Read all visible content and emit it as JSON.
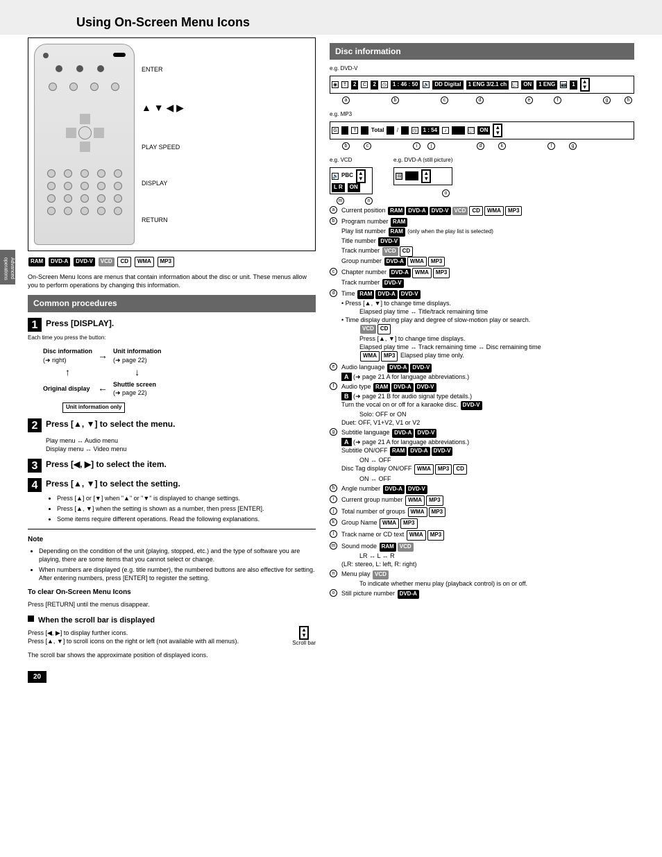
{
  "page": {
    "number": "20",
    "side_tab": "Advanced operations",
    "title": "Using On-Screen Menu Icons"
  },
  "remote_labels": {
    "enter": "ENTER",
    "arrows": "▲ ▼ ◀ ▶",
    "play_speed": "PLAY SPEED",
    "display": "DISPLAY",
    "return": "RETURN"
  },
  "format_row": {
    "ram": "RAM",
    "dvda": "DVD-A",
    "dvdv": "DVD-V",
    "vcd": "VCD",
    "cd": "CD",
    "wma": "WMA",
    "mp3": "MP3"
  },
  "intro": "On-Screen Menu Icons are menus that contain information about the disc or unit. These menus allow you to perform operations by changing this information.",
  "common_section": {
    "bar": "Common procedures",
    "step1_label": "Press [DISPLAY].",
    "flow": {
      "disc_info_top": "Disc information",
      "disc_info_sub": "(➜ right)",
      "unit_info_top": "Unit information",
      "unit_info_sub": "(➜ page 22)",
      "shuttle_top": "Shuttle screen",
      "shuttle_sub": "(➜ page 22)",
      "orig_top": "Original display",
      "unit_box": "Unit information only"
    },
    "step2_label": "Press [▲, ▼] to select the menu.",
    "step2_flow": "Play menu ↔ Audio menu\nDisplay menu ↔ Video menu",
    "step3_label": "Press [◀, ▶] to select the item.",
    "step4_label": "Press [▲, ▼] to select the setting.",
    "bullets": [
      "Press [▲] or [▼] when \"▲\" or \"▼\" is displayed to change settings.",
      "Press [▲, ▼] when the setting is shown as a number, then press [ENTER].",
      "Some items require different operations. Read the following explanations."
    ],
    "notes_heading": "Note",
    "notes": [
      "Depending on the condition of the unit (playing, stopped, etc.) and the type of software you are playing, there are some items that you cannot select or change.",
      "When numbers are displayed (e.g. title number), the numbered buttons are also effective for setting. After entering numbers, press [ENTER] to register the setting."
    ],
    "clear_heading": "To clear On-Screen Menu Icons",
    "clear_text": "Press [RETURN] until the menus disappear.",
    "scroll_heading": "When the scroll bar is displayed",
    "scroll_text1": "Press [◀, ▶] to display further icons.\nPress [▲, ▼] to scroll icons on the right or left (not available with all menus).",
    "scroll_text2": "The scroll bar shows the approximate position of displayed icons.",
    "arrow_label": "Scroll bar"
  },
  "disc_info": {
    "bar": "Disc information",
    "osd1": {
      "title_num": "2",
      "chapter_num": "2",
      "time": "1 : 46 : 50",
      "digital": "Digital",
      "audio": "1 ENG  3/2.1 ch",
      "sub": "1 ENG",
      "on": "ON",
      "angle": "1"
    },
    "osd2": {
      "total": "Total",
      "tracks_sep": "/",
      "time": "1 : 54",
      "on": "ON"
    },
    "osd_vcd": {
      "pbc": "PBC",
      "lr": "L R",
      "on": "ON",
      "label": "e.g. VCD"
    },
    "osd_dvda": {
      "label": "e.g. DVD-A (still picture)"
    },
    "letters_row1": [
      "a",
      "b",
      "c",
      "d",
      "e",
      "f",
      "g",
      "h"
    ],
    "letters_row2": [
      "b",
      "c",
      "i",
      "j",
      "d",
      "k",
      "l",
      "g"
    ],
    "letters_vcd": [
      "m",
      "n"
    ],
    "letters_dvda": [
      "o"
    ],
    "a": {
      "label": "Current position",
      "formats": [
        "RAM",
        "DVD-A",
        "DVD-V",
        "VCD",
        "CD",
        "WMA",
        "MP3"
      ]
    },
    "b": {
      "label": "Program number",
      "b1": "RAM",
      "l2": "Play list number",
      "b2": "RAM",
      "note2": "(only when the play list is selected)",
      "l3": "Title number",
      "b3": "DVD-V",
      "l4": "Track number",
      "b4": [
        "VCD",
        "CD"
      ],
      "l5": "Group number",
      "b5": [
        "DVD-A",
        "WMA",
        "MP3"
      ]
    },
    "c": {
      "label": "Chapter number",
      "c1": [
        "DVD-A",
        "WMA",
        "MP3"
      ],
      "l2": "Track number",
      "c2": "DVD-V"
    },
    "d": {
      "label": "Time",
      "formats": [
        "RAM",
        "DVD-A",
        "DVD-V"
      ],
      "b1": "Press [▲, ▼] to change time displays.",
      "b1a": "Elapsed play time ↔ Title/track remaining time",
      "b2": "Time display during play and degree of slow-motion play or search.",
      "sub_vcd": [
        "VCD",
        "CD"
      ],
      "sub_vcd_txt": "Press [▲, ▼] to change time displays.",
      "sub_vcd_txt2": "Elapsed play time ↔ Track remaining time ↔ Disc remaining time",
      "sub_wma": [
        "WMA",
        "MP3"
      ],
      "sub_wma_txt": "Elapsed play time only."
    },
    "e": {
      "label": "Audio language",
      "formats": [
        "DVD-A",
        "DVD-V"
      ],
      "note": "(➜ page 21 A for language abbreviations.)"
    },
    "f": {
      "label": "Audio type",
      "formats": [
        "RAM",
        "DVD-A",
        "DVD-V"
      ],
      "note": "(➜ page 21 B for audio signal type details.)",
      "l2": "Turn the vocal on or off for a karaoke disc.",
      "b2": "DVD-V",
      "l2b": "Solo: OFF or ON\nDuet: OFF, V1+V2, V1 or V2"
    },
    "g": {
      "label": "Subtitle language",
      "formats": [
        "DVD-A",
        "DVD-V"
      ],
      "note": "(➜ page 21 A for language abbreviations.)",
      "l2": "Subtitle ON/OFF",
      "b2": [
        "RAM",
        "DVD-A",
        "DVD-V"
      ],
      "l2b": "ON ↔ OFF",
      "l3": "Disc Tag display ON/OFF",
      "b3": [
        "WMA",
        "MP3",
        "CD"
      ],
      "l3b": "ON ↔ OFF"
    },
    "h": {
      "label": "Angle number",
      "formats": [
        "DVD-A",
        "DVD-V"
      ]
    },
    "i": {
      "label": "Current group number",
      "formats": [
        "WMA",
        "MP3"
      ]
    },
    "j": {
      "label": "Total number of groups",
      "formats": [
        "WMA",
        "MP3"
      ]
    },
    "k": {
      "label": "Group Name",
      "formats": [
        "WMA",
        "MP3"
      ]
    },
    "l": {
      "label": "Track name or CD text",
      "formats": [
        "WMA",
        "MP3"
      ]
    },
    "m": {
      "label": "Sound mode",
      "formats": [
        "RAM",
        "VCD"
      ],
      "sub": "LR ↔ L ↔ R\n(LR: stereo, L: left, R: right)"
    },
    "n": {
      "label": "Menu play",
      "formats": [
        "VCD"
      ],
      "sub": "To indicate whether menu play (playback control) is on or off."
    },
    "o": {
      "label": "Still picture number",
      "formats": [
        "DVD-A"
      ]
    }
  }
}
